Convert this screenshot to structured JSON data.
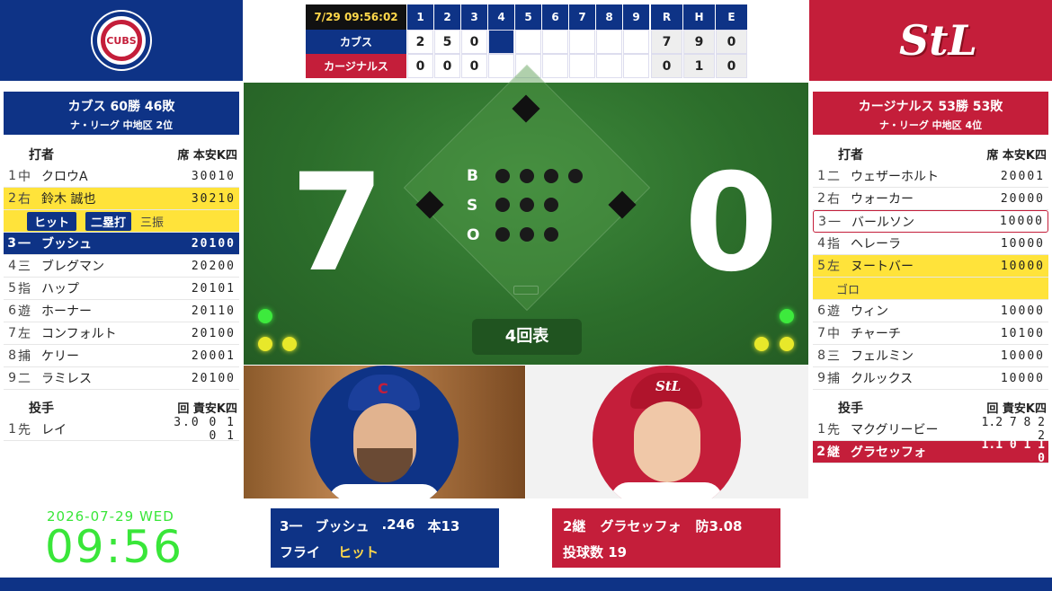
{
  "scoreboard": {
    "time": "7/29 09:56:02",
    "innings": [
      "1",
      "2",
      "3",
      "4",
      "5",
      "6",
      "7",
      "8",
      "9"
    ],
    "rhe": [
      "R",
      "H",
      "E"
    ],
    "teams": [
      {
        "name": "カブス",
        "scores": [
          "2",
          "5",
          "0",
          "",
          "",
          "",
          "",
          "",
          ""
        ],
        "rhe": [
          "7",
          "9",
          "0"
        ]
      },
      {
        "name": "カージナルス",
        "scores": [
          "0",
          "0",
          "0",
          "",
          "",
          "",
          "",
          "",
          ""
        ],
        "rhe": [
          "0",
          "1",
          "0"
        ]
      }
    ]
  },
  "home": {
    "logo_text": "CUBS",
    "record": "カブス 60勝 46敗",
    "standing": "ナ・リーグ 中地区 2位",
    "batters_header": "打者",
    "stats_header": "席 本安K四",
    "batters": [
      {
        "num": "1",
        "pos": "中",
        "name": "クロウA",
        "stats": "30010"
      },
      {
        "num": "2",
        "pos": "右",
        "name": "鈴木 誠也",
        "stats": "30210"
      },
      {
        "num": "3",
        "pos": "一",
        "name": "ブッシュ",
        "stats": "20100"
      },
      {
        "num": "4",
        "pos": "三",
        "name": "ブレグマン",
        "stats": "20200"
      },
      {
        "num": "5",
        "pos": "指",
        "name": "ハップ",
        "stats": "20101"
      },
      {
        "num": "6",
        "pos": "遊",
        "name": "ホーナー",
        "stats": "20110"
      },
      {
        "num": "7",
        "pos": "左",
        "name": "コンフォルト",
        "stats": "20100"
      },
      {
        "num": "8",
        "pos": "捕",
        "name": "ケリー",
        "stats": "20001"
      },
      {
        "num": "9",
        "pos": "二",
        "name": "ラミレス",
        "stats": "20100"
      }
    ],
    "results": [
      "ヒット",
      "二塁打",
      "三振"
    ],
    "pitchers_header": "投手",
    "pitch_stats_header": "回 責安K四",
    "pitchers": [
      {
        "num": "1",
        "pos": "先",
        "name": "レイ",
        "stats": "3.0 0 1 0 1"
      }
    ]
  },
  "away": {
    "logo_text": "StL",
    "record": "カージナルス 53勝 53敗",
    "standing": "ナ・リーグ 中地区 4位",
    "batters_header": "打者",
    "stats_header": "席 本安K四",
    "batters": [
      {
        "num": "1",
        "pos": "二",
        "name": "ウェザーホルト",
        "stats": "20001"
      },
      {
        "num": "2",
        "pos": "右",
        "name": "ウォーカー",
        "stats": "20000"
      },
      {
        "num": "3",
        "pos": "一",
        "name": "バールソン",
        "stats": "10000"
      },
      {
        "num": "4",
        "pos": "指",
        "name": "ヘレーラ",
        "stats": "10000"
      },
      {
        "num": "5",
        "pos": "左",
        "name": "ヌートバー",
        "stats": "10000"
      },
      {
        "num": "6",
        "pos": "遊",
        "name": "ウィン",
        "stats": "10000"
      },
      {
        "num": "7",
        "pos": "中",
        "name": "チャーチ",
        "stats": "10100"
      },
      {
        "num": "8",
        "pos": "三",
        "name": "フェルミン",
        "stats": "10000"
      },
      {
        "num": "9",
        "pos": "捕",
        "name": "クルックス",
        "stats": "10000"
      }
    ],
    "results": [
      "ゴロ"
    ],
    "pitchers_header": "投手",
    "pitch_stats_header": "回 責安K四",
    "pitchers": [
      {
        "num": "1",
        "pos": "先",
        "name": "マクグリービー",
        "stats": "1.2 7 8 2 2"
      },
      {
        "num": "2",
        "pos": "継",
        "name": "グラセッフォ",
        "stats": "1.1 0 1 1 0"
      }
    ]
  },
  "field": {
    "home_score": "7",
    "away_score": "0",
    "bso": [
      "B",
      "S",
      "O"
    ],
    "inning": "4回表"
  },
  "clock": {
    "date": "2026-07-29 WED",
    "time": "09:56"
  },
  "batter_info": {
    "line1_pos": "3一",
    "line1_name": "ブッシュ",
    "line1_avg": ".246",
    "line1_hr": "本13",
    "line2_a": "フライ",
    "line2_b": "ヒット"
  },
  "pitcher_info": {
    "line1_pos": "2継",
    "line1_name": "グラセッフォ",
    "line1_era": "防3.08",
    "line2": "投球数 19"
  },
  "colors": {
    "cubs_blue": "#0e3386",
    "cards_red": "#c41e3a",
    "highlight": "#ffe33a",
    "field_green": "#2c6e2b",
    "clock_green": "#39e639"
  }
}
